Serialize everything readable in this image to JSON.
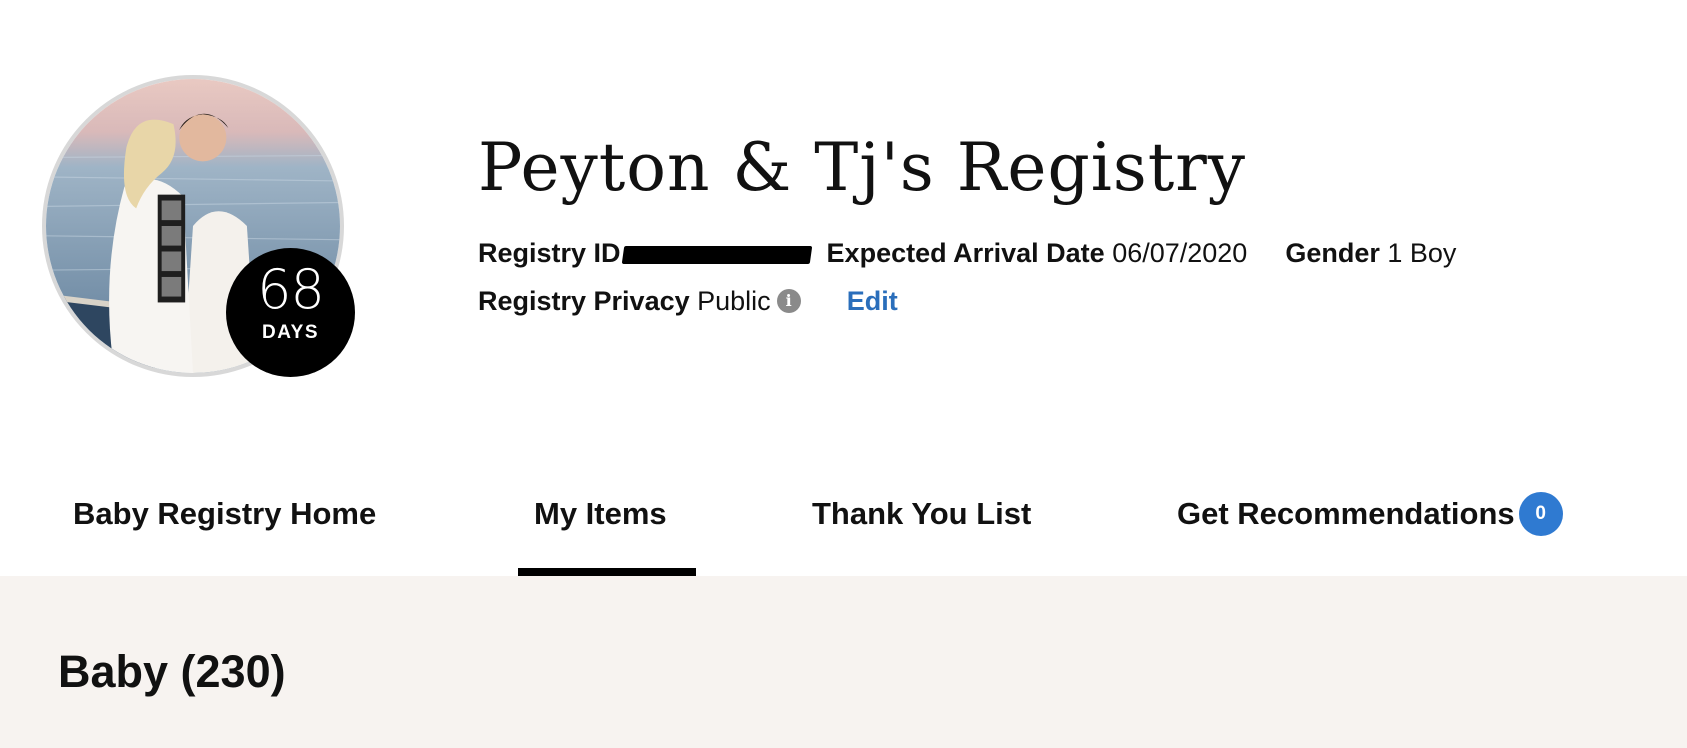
{
  "profile": {
    "photo_description": "couple-with-ultrasound-photo",
    "countdown": {
      "number": "68",
      "label": "DAYS"
    }
  },
  "registry": {
    "title": "Peyton & Tj's Registry",
    "id_label": "Registry ID",
    "arrival_label": "Expected Arrival Date",
    "arrival_value": "06/07/2020",
    "gender_label": "Gender",
    "gender_value": "1 Boy",
    "privacy_label": "Registry Privacy",
    "privacy_value": "Public",
    "info_icon": "info-icon",
    "edit_label": "Edit"
  },
  "tabs": [
    {
      "label": "Baby Registry Home",
      "active": false
    },
    {
      "label": "My Items",
      "active": true
    },
    {
      "label": "Thank You List",
      "active": false
    },
    {
      "label": "Get Recommendations",
      "active": false,
      "badge": "0"
    }
  ],
  "section": {
    "title": "Baby (230)"
  },
  "colors": {
    "link": "#2a6ebb",
    "badge": "#2f7ad1",
    "section_bg": "#f7f3f0",
    "active_underline": "#000000"
  }
}
